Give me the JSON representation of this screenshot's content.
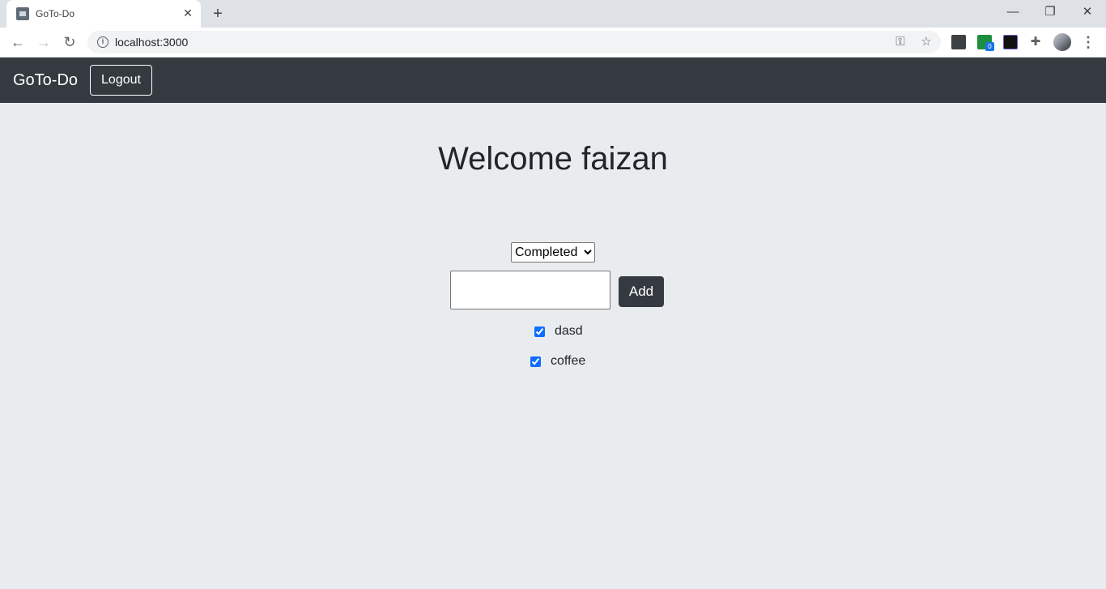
{
  "browser": {
    "tab_title": "GoTo-Do",
    "url": "localhost:3000",
    "extension_badge": "0"
  },
  "navbar": {
    "brand": "GoTo-Do",
    "logout_label": "Logout"
  },
  "main": {
    "welcome": "Welcome faizan",
    "filter": {
      "selected": "Completed",
      "options": [
        "Completed"
      ]
    },
    "input": {
      "value": "",
      "placeholder": ""
    },
    "add_label": "Add",
    "todos": [
      {
        "text": "dasd",
        "checked": true
      },
      {
        "text": "coffee",
        "checked": true
      }
    ]
  }
}
